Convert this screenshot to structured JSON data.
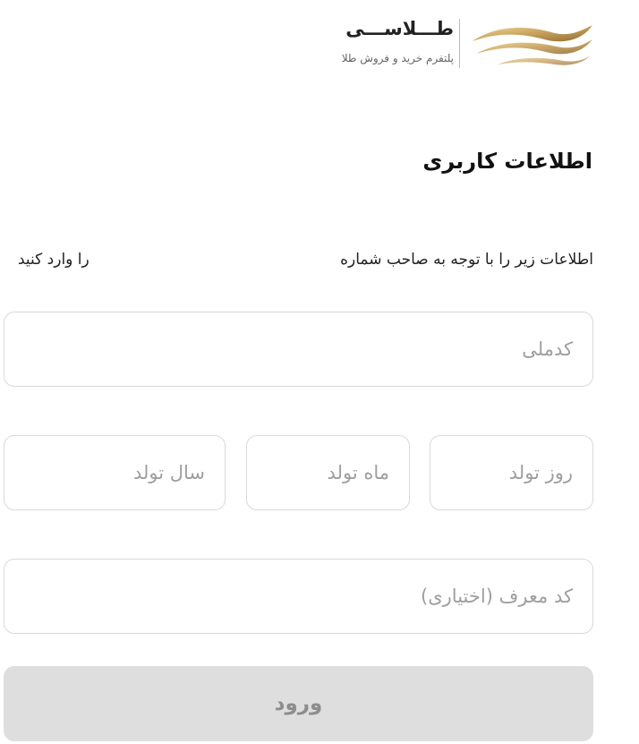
{
  "brand": {
    "name": "طـــلاســـی",
    "tagline": "پلتفرم خرید و فروش طلا",
    "accent_color": "#c9a96b"
  },
  "page": {
    "title": "اطلاعات کاربری"
  },
  "instruction": {
    "main": "اطلاعات زیر را با توجه به صاحب شماره",
    "tail": "را وارد کنید"
  },
  "form": {
    "national_id": {
      "placeholder": "کدملی",
      "value": ""
    },
    "birth_day": {
      "placeholder": "روز تولد",
      "value": ""
    },
    "birth_month": {
      "placeholder": "ماه تولد",
      "value": ""
    },
    "birth_year": {
      "placeholder": "سال تولد",
      "value": ""
    },
    "referral_code": {
      "placeholder": "کد معرف (اختیاری)",
      "value": ""
    },
    "submit_label": "ورود"
  }
}
